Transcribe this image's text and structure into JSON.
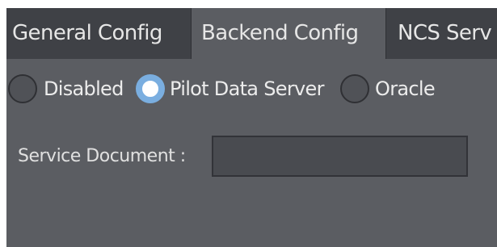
{
  "tabs": [
    {
      "label": "General Config",
      "active": false
    },
    {
      "label": "Backend Config",
      "active": true
    },
    {
      "label": "NCS Serv",
      "active": false
    }
  ],
  "backend": {
    "options": [
      {
        "label": "Disabled",
        "selected": false
      },
      {
        "label": "Pilot Data Server",
        "selected": true
      },
      {
        "label": "Oracle",
        "selected": false
      }
    ],
    "service_document": {
      "label": "Service Document :",
      "value": ""
    }
  },
  "colors": {
    "panel": "#5b5d62",
    "tab_inactive": "#3f4146",
    "radio_selected": "#7aaee0"
  }
}
